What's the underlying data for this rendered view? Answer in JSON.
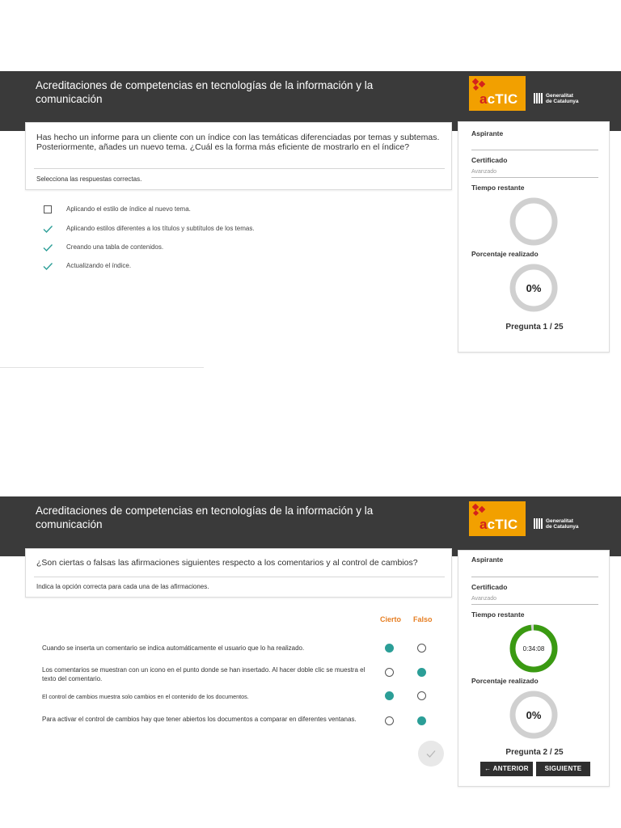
{
  "app": {
    "title": "Acreditaciones de competencias en tecnologías de la información y la comunicación",
    "logo_text_prefix": "a",
    "logo_text_main": "cTIC",
    "gencat_line1": "Generalitat",
    "gencat_line2": "de Catalunya",
    "brand_color": "#f2a000",
    "accent_color": "#2b9e97",
    "header_color": "#3a3a3a"
  },
  "screen1": {
    "question": "Has hecho un informe para un cliente con un índice con las temáticas diferenciadas por temas y subtemas. Posteriormente, añades un nuevo tema. ¿Cuál es la forma más eficiente de mostrarlo en el índice?",
    "instruction": "Selecciona las respuestas correctas.",
    "options": [
      {
        "label": "Aplicando el estilo de índice al nuevo tema.",
        "state": "checkbox-empty",
        "icon": "checkbox-icon"
      },
      {
        "label": "Aplicando estilos diferentes a los títulos y subtítulos de los temas.",
        "state": "checked",
        "icon": "checkmark-icon"
      },
      {
        "label": "Creando una tabla de contenidos.",
        "state": "checked",
        "icon": "checkmark-icon"
      },
      {
        "label": "Actualizando el índice.",
        "state": "checked",
        "icon": "checkmark-icon"
      }
    ],
    "sidebar": {
      "aspirante_label": "Aspirante",
      "certificado_label": "Certificado",
      "certificado_value": "Avanzado",
      "tiempo_label": "Tiempo restante",
      "tiempo_value": "",
      "tiempo_fraction": 0,
      "porcentaje_label": "Porcentaje realizado",
      "porcentaje_value": "0%",
      "porcentaje_fraction": 0,
      "counter": "Pregunta 1 / 25"
    }
  },
  "screen2": {
    "question": "¿Son ciertas o falsas las afirmaciones siguientes respecto a los comentarios y al control de cambios?",
    "instruction": "Indica la opción correcta para cada una de las afirmaciones.",
    "col_true": "Cierto",
    "col_false": "Falso",
    "statements": [
      {
        "text": "Cuando se inserta un comentario se indica automáticamente el usuario que lo ha realizado.",
        "answer": "cierto"
      },
      {
        "text": "Los comentarios se muestran con un icono en el punto donde se han insertado. Al hacer doble clic se muestra el texto del comentario.",
        "answer": "falso"
      },
      {
        "text": "El control de cambios muestra solo cambios en el contenido de los documentos.",
        "answer": "cierto"
      },
      {
        "text": "Para activar el control de cambios hay que tener abiertos los documentos a comparar en diferentes ventanas.",
        "answer": "falso"
      }
    ],
    "sidebar": {
      "aspirante_label": "Aspirante",
      "certificado_label": "Certificado",
      "certificado_value": "Avanzado",
      "tiempo_label": "Tiempo restante",
      "tiempo_value": "0:34:08",
      "tiempo_fraction": 0.98,
      "tiempo_color": "#3a9a12",
      "porcentaje_label": "Porcentaje realizado",
      "porcentaje_value": "0%",
      "porcentaje_fraction": 0,
      "counter": "Pregunta 2 / 25",
      "prev_label": "← ANTERIOR",
      "next_label": "SIGUIENTE"
    }
  }
}
